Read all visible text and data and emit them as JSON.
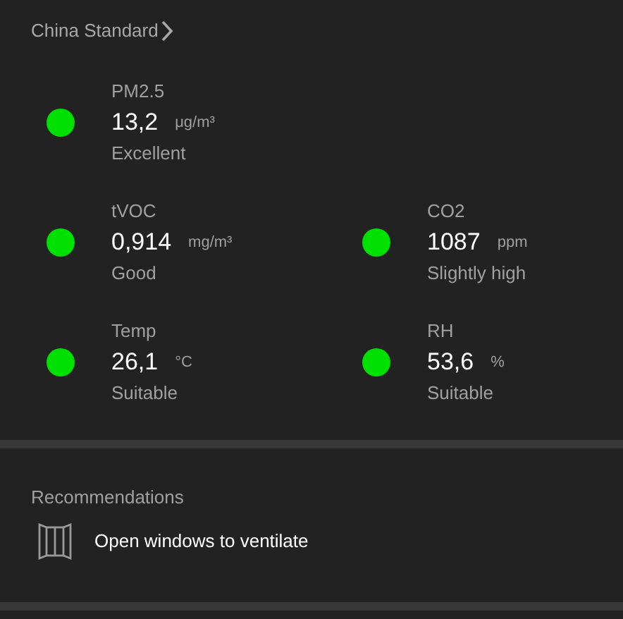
{
  "standard": {
    "label": "China Standard"
  },
  "metric_rows": [
    [
      {
        "name": "PM2.5",
        "value": "13,2",
        "unit": "μg/m³",
        "status": "Excellent",
        "color": "#00e000"
      }
    ],
    [
      {
        "name": "tVOC",
        "value": "0,914",
        "unit": "mg/m³",
        "status": "Good",
        "color": "#00e000"
      },
      {
        "name": "CO2",
        "value": "1087",
        "unit": "ppm",
        "status": "Slightly high",
        "color": "#00e000"
      }
    ],
    [
      {
        "name": "Temp",
        "value": "26,1",
        "unit": "°C",
        "status": "Suitable",
        "color": "#00e000"
      },
      {
        "name": "RH",
        "value": "53,6",
        "unit": "%",
        "status": "Suitable",
        "color": "#00e000"
      }
    ]
  ],
  "recommendations": {
    "title": "Recommendations",
    "items": [
      {
        "text": "Open windows to ventilate"
      }
    ]
  }
}
